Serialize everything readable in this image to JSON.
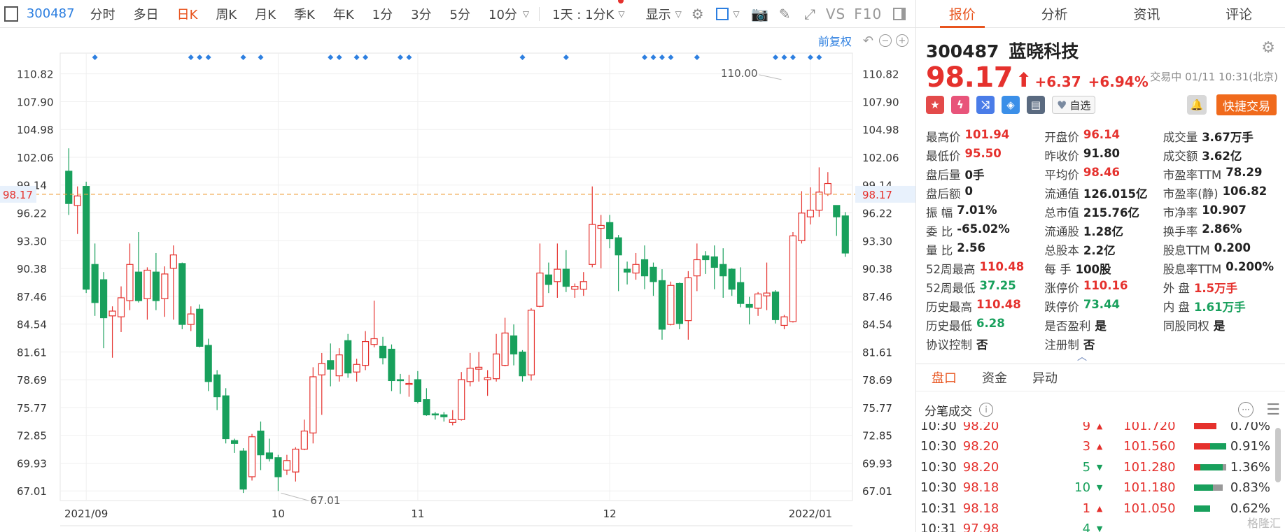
{
  "toolbar": {
    "code": "300487",
    "tabs": [
      "分时",
      "多日",
      "日K",
      "周K",
      "月K",
      "季K",
      "年K",
      "1分",
      "3分",
      "5分",
      "10分"
    ],
    "active_tab": "日K",
    "period_select": "1天 : 1分K",
    "display_label": "显示",
    "vs_label": "VS",
    "f10_label": "F10"
  },
  "chart_ctrl": {
    "fq_label": "前复权"
  },
  "chart_data": {
    "type": "candlestick",
    "yticks": [
      110.82,
      107.9,
      104.98,
      102.06,
      99.14,
      96.22,
      93.3,
      90.38,
      87.46,
      84.54,
      81.61,
      78.69,
      75.77,
      72.85,
      69.93,
      67.01
    ],
    "ylim": [
      66.0,
      113.0
    ],
    "xticks": [
      {
        "label": "2021/09",
        "index": 2
      },
      {
        "label": "10",
        "index": 24
      },
      {
        "label": "11",
        "index": 40
      },
      {
        "label": "12",
        "index": 62
      },
      {
        "label": "2022/01",
        "index": 85
      }
    ],
    "current_price": 98.17,
    "high_marker": {
      "label": "110.00",
      "index": 82
    },
    "low_marker": {
      "label": "67.01",
      "index": 24
    },
    "event_markers": [
      3,
      14,
      15,
      16,
      20,
      22,
      30,
      31,
      33,
      34,
      38,
      39,
      52,
      57,
      66,
      67,
      68,
      69,
      72,
      81,
      82,
      83,
      85,
      86
    ],
    "candles": [
      [
        100.6,
        97.2,
        103.0,
        96.0
      ],
      [
        97.0,
        98.0,
        99.0,
        94.0
      ],
      [
        99.0,
        88.2,
        99.5,
        87.8
      ],
      [
        90.8,
        86.8,
        93.0,
        85.4
      ],
      [
        89.2,
        85.2,
        90.0,
        82.0
      ],
      [
        85.4,
        85.9,
        86.4,
        81.0
      ],
      [
        85.3,
        87.3,
        88.5,
        83.7
      ],
      [
        87.0,
        90.8,
        93.0,
        86.0
      ],
      [
        90.0,
        87.0,
        94.2,
        86.8
      ],
      [
        87.2,
        90.2,
        90.5,
        85.0
      ],
      [
        90.0,
        87.0,
        92.0,
        86.0
      ],
      [
        87.2,
        89.8,
        90.6,
        85.3
      ],
      [
        90.4,
        91.8,
        92.8,
        85.0
      ],
      [
        90.9,
        84.5,
        91.0,
        84.0
      ],
      [
        84.5,
        85.6,
        86.4,
        83.8
      ],
      [
        86.1,
        82.2,
        86.6,
        82.1
      ],
      [
        82.3,
        78.5,
        83.0,
        77.5
      ],
      [
        79.2,
        76.9,
        79.7,
        75.5
      ],
      [
        77.0,
        72.5,
        77.8,
        72.0
      ],
      [
        72.3,
        72.0,
        72.5,
        71.0
      ],
      [
        71.2,
        67.2,
        71.5,
        66.8
      ],
      [
        68.5,
        72.7,
        73.0,
        68.1
      ],
      [
        73.3,
        70.8,
        74.3,
        69.2
      ],
      [
        71.0,
        70.4,
        72.5,
        70.1
      ],
      [
        70.5,
        68.5,
        70.8,
        67.0
      ],
      [
        69.2,
        70.2,
        70.8,
        68.7
      ],
      [
        69.0,
        71.4,
        71.6,
        68.0
      ],
      [
        71.4,
        73.3,
        74.5,
        71.3
      ],
      [
        73.1,
        79.0,
        80.0,
        72.0
      ],
      [
        79.2,
        80.4,
        81.5,
        75.0
      ],
      [
        80.7,
        79.8,
        82.5,
        78.0
      ],
      [
        79.1,
        81.3,
        82.0,
        78.5
      ],
      [
        82.8,
        79.4,
        83.5,
        78.9
      ],
      [
        79.5,
        80.3,
        80.9,
        78.5
      ],
      [
        80.2,
        82.7,
        83.8,
        79.7
      ],
      [
        82.4,
        83.0,
        87.0,
        82.1
      ],
      [
        82.2,
        81.0,
        83.2,
        80.3
      ],
      [
        81.9,
        78.6,
        82.4,
        77.5
      ],
      [
        78.7,
        78.6,
        79.3,
        77.2
      ],
      [
        78.3,
        78.3,
        79.2,
        76.9
      ],
      [
        78.7,
        76.4,
        79.6,
        76.2
      ],
      [
        76.6,
        75.0,
        77.8,
        74.9
      ],
      [
        75.1,
        75.0,
        75.3,
        74.5
      ],
      [
        75.0,
        74.8,
        75.3,
        74.3
      ],
      [
        74.2,
        74.5,
        75.5,
        73.9
      ],
      [
        74.5,
        78.7,
        79.5,
        74.4
      ],
      [
        78.5,
        79.9,
        81.5,
        78.0
      ],
      [
        79.8,
        80.0,
        81.6,
        78.5
      ],
      [
        78.7,
        78.9,
        79.7,
        77.0
      ],
      [
        78.8,
        81.4,
        83.5,
        78.5
      ],
      [
        80.2,
        83.6,
        85.2,
        80.1
      ],
      [
        83.3,
        81.4,
        84.5,
        80.2
      ],
      [
        81.6,
        79.1,
        81.8,
        78.5
      ],
      [
        79.2,
        86.0,
        86.2,
        78.6
      ],
      [
        86.4,
        89.9,
        93.0,
        86.3
      ],
      [
        89.7,
        88.7,
        91.0,
        87.8
      ],
      [
        89.0,
        90.3,
        93.0,
        87.3
      ],
      [
        90.3,
        88.5,
        92.3,
        87.9
      ],
      [
        88.2,
        88.5,
        88.8,
        87.3
      ],
      [
        88.2,
        89.0,
        90.0,
        87.5
      ],
      [
        90.8,
        95.0,
        99.0,
        90.5
      ],
      [
        94.6,
        94.9,
        96.0,
        90.4
      ],
      [
        95.2,
        93.5,
        96.0,
        92.5
      ],
      [
        93.6,
        91.8,
        93.9,
        88.0
      ],
      [
        90.3,
        90.0,
        91.1,
        88.7
      ],
      [
        89.9,
        90.8,
        92.0,
        89.2
      ],
      [
        91.3,
        89.6,
        92.8,
        88.2
      ],
      [
        90.5,
        89.0,
        91.0,
        87.5
      ],
      [
        89.1,
        84.0,
        90.3,
        82.9
      ],
      [
        84.5,
        88.6,
        89.0,
        84.4
      ],
      [
        88.8,
        84.6,
        88.9,
        84.0
      ],
      [
        84.9,
        89.4,
        90.1,
        82.9
      ],
      [
        89.6,
        91.3,
        93.0,
        88.0
      ],
      [
        91.7,
        91.3,
        92.2,
        89.8
      ],
      [
        91.6,
        90.5,
        92.8,
        88.2
      ],
      [
        90.8,
        89.6,
        92.5,
        87.3
      ],
      [
        90.3,
        88.2,
        90.4,
        87.5
      ],
      [
        88.9,
        86.7,
        90.5,
        86.3
      ],
      [
        86.6,
        86.3,
        87.4,
        84.5
      ],
      [
        86.2,
        87.7,
        87.9,
        85.4
      ],
      [
        87.5,
        87.8,
        91.0,
        86.0
      ],
      [
        87.9,
        85.0,
        88.1,
        84.6
      ],
      [
        84.4,
        85.3,
        85.5,
        84.0
      ],
      [
        84.8,
        93.8,
        94.2,
        84.7
      ],
      [
        93.3,
        96.2,
        98.5,
        93.0
      ],
      [
        95.8,
        96.5,
        98.9,
        95.0
      ],
      [
        96.5,
        98.4,
        101.0,
        95.8
      ],
      [
        98.2,
        99.3,
        100.5,
        98.0
      ],
      [
        97.0,
        95.8,
        96.9,
        93.8
      ],
      [
        95.9,
        92.0,
        96.3,
        91.6
      ]
    ]
  },
  "quote": {
    "tabs": [
      "报价",
      "分析",
      "资讯",
      "评论"
    ],
    "active_tab": "报价",
    "code": "300487",
    "name": "蓝晓科技",
    "price": "98.17",
    "change": "+6.37",
    "change_pct": "+6.94%",
    "status": "交易中 01/11 10:31(北京)",
    "zixuan_label": "自选",
    "quick_trade_label": "快捷交易",
    "stats": [
      [
        {
          "label": "最高价",
          "value": "101.94",
          "color": "red"
        },
        {
          "label": "开盘价",
          "value": "96.14",
          "color": "red"
        },
        {
          "label": "成交量",
          "value": "3.67万手",
          "color": "dark"
        }
      ],
      [
        {
          "label": "最低价",
          "value": "95.50",
          "color": "red"
        },
        {
          "label": "昨收价",
          "value": "91.80",
          "color": "dark"
        },
        {
          "label": "成交额",
          "value": "3.62亿",
          "color": "dark"
        }
      ],
      [
        {
          "label": "盘后量",
          "value": "0手",
          "color": "dark"
        },
        {
          "label": "平均价",
          "value": "98.46",
          "color": "red"
        },
        {
          "label": "市盈率TTM",
          "value": "78.29",
          "color": "dark"
        }
      ],
      [
        {
          "label": "盘后额",
          "value": "0",
          "color": "dark"
        },
        {
          "label": "流通值",
          "value": "126.015亿",
          "color": "dark"
        },
        {
          "label": "市盈率(静)",
          "value": "106.82",
          "color": "dark"
        }
      ],
      [
        {
          "label": "振 幅",
          "value": "7.01%",
          "color": "dark"
        },
        {
          "label": "总市值",
          "value": "215.76亿",
          "color": "dark"
        },
        {
          "label": "市净率",
          "value": "10.907",
          "color": "dark"
        }
      ],
      [
        {
          "label": "委 比",
          "value": "-65.02%",
          "color": "dark"
        },
        {
          "label": "流通股",
          "value": "1.28亿",
          "color": "dark"
        },
        {
          "label": "换手率",
          "value": "2.86%",
          "color": "dark"
        }
      ],
      [
        {
          "label": "量 比",
          "value": "2.56",
          "color": "dark"
        },
        {
          "label": "总股本",
          "value": "2.2亿",
          "color": "dark"
        },
        {
          "label": "股息TTM",
          "value": "0.200",
          "color": "dark"
        }
      ],
      [
        {
          "label": "52周最高",
          "value": "110.48",
          "color": "red"
        },
        {
          "label": "每 手",
          "value": "100股",
          "color": "dark"
        },
        {
          "label": "股息率TTM",
          "value": "0.200%",
          "color": "dark"
        }
      ],
      [
        {
          "label": "52周最低",
          "value": "37.25",
          "color": "green"
        },
        {
          "label": "涨停价",
          "value": "110.16",
          "color": "red"
        },
        {
          "label": "外 盘",
          "value": "1.5万手",
          "color": "red"
        }
      ],
      [
        {
          "label": "历史最高",
          "value": "110.48",
          "color": "red"
        },
        {
          "label": "跌停价",
          "value": "73.44",
          "color": "green"
        },
        {
          "label": "内 盘",
          "value": "1.61万手",
          "color": "green"
        }
      ],
      [
        {
          "label": "历史最低",
          "value": "6.28",
          "color": "green"
        },
        {
          "label": "是否盈利",
          "value": "是",
          "color": "dark"
        },
        {
          "label": "同股同权",
          "value": "是",
          "color": "dark"
        }
      ],
      [
        {
          "label": "协议控制",
          "value": "否",
          "color": "dark"
        },
        {
          "label": "注册制",
          "value": "否",
          "color": "dark"
        },
        {
          "label": "",
          "value": "",
          "color": "dark"
        }
      ]
    ],
    "sub_tabs": [
      "盘口",
      "资金",
      "异动"
    ],
    "active_sub_tab": "盘口",
    "trades_title": "分笔成交",
    "trades": [
      {
        "time": "10:30",
        "price": "98.20",
        "vol": "9",
        "dir": "up",
        "buy_price": "101.720",
        "pct": "0.70%",
        "bar": [
          0.7,
          0.0,
          0.0
        ]
      },
      {
        "time": "10:30",
        "price": "98.20",
        "vol": "3",
        "dir": "up",
        "buy_price": "101.560",
        "pct": "0.91%",
        "bar": [
          0.5,
          0.5,
          0.0
        ]
      },
      {
        "time": "10:30",
        "price": "98.20",
        "vol": "5",
        "dir": "down",
        "buy_price": "101.280",
        "pct": "1.36%",
        "bar": [
          0.2,
          0.7,
          0.1
        ]
      },
      {
        "time": "10:30",
        "price": "98.18",
        "vol": "10",
        "dir": "down",
        "buy_price": "101.180",
        "pct": "0.83%",
        "bar": [
          0.0,
          0.6,
          0.3
        ]
      },
      {
        "time": "10:31",
        "price": "98.18",
        "vol": "1",
        "dir": "up",
        "buy_price": "101.050",
        "pct": "0.62%",
        "bar": [
          0.0,
          0.5,
          0.0
        ]
      },
      {
        "time": "10:31",
        "price": "97.98",
        "vol": "4",
        "dir": "down",
        "buy_price": "",
        "pct": "",
        "bar": [
          0.0,
          0.0,
          0.0
        ]
      }
    ],
    "watermark": "格隆汇"
  },
  "colors": {
    "up": "#e5312d",
    "down": "#18a05c",
    "accent": "#e8541e",
    "link": "#2d7fe0"
  }
}
